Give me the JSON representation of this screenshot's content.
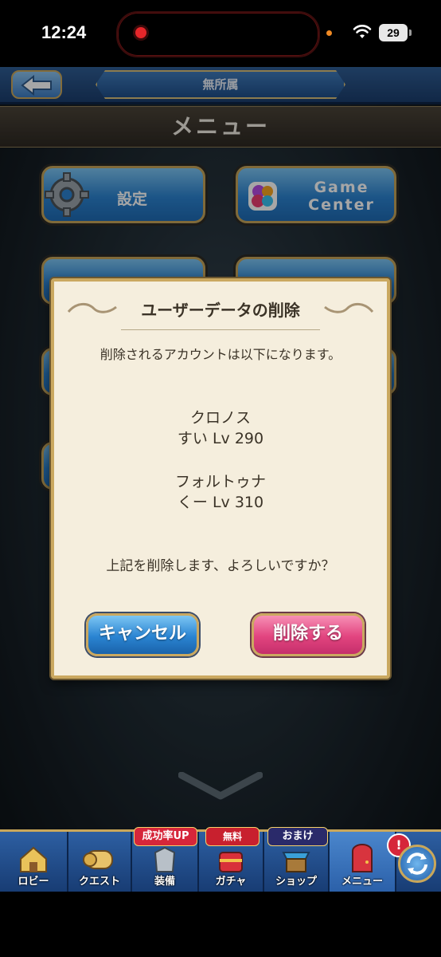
{
  "status_bar": {
    "time": "12:24",
    "battery": "29"
  },
  "header": {
    "affiliation": "無所属",
    "page_title": "メニュー"
  },
  "menu_buttons": {
    "settings": "設定",
    "gamecenter_line1": "Game",
    "gamecenter_line2": "Center"
  },
  "dialog": {
    "title": "ユーザーデータの削除",
    "description": "削除されるアカウントは以下になります。",
    "accounts": [
      {
        "server": "クロノス",
        "info": "すい Lv 290"
      },
      {
        "server": "フォルトゥナ",
        "info": "くー Lv 310"
      }
    ],
    "confirm": "上記を削除します、よろしいですか？",
    "cancel_label": "キャンセル",
    "delete_label": "削除する"
  },
  "bottom_nav": {
    "items": [
      {
        "label": "ロビー",
        "icon": "lobby-icon"
      },
      {
        "label": "クエスト",
        "icon": "quest-icon"
      },
      {
        "label": "装備",
        "icon": "equipment-icon",
        "badge": "成功率UP"
      },
      {
        "label": "ガチャ",
        "icon": "gacha-icon",
        "badge": "無料"
      },
      {
        "label": "ショップ",
        "icon": "shop-icon",
        "badge": "おまけ"
      },
      {
        "label": "メニュー",
        "icon": "menu-door-icon"
      }
    ],
    "alert_mark": "!"
  },
  "colors": {
    "dialog_bg": "#f5eedd",
    "gold": "#caa860",
    "blue_button": "#2a84d2",
    "pink_button": "#e2447f",
    "nav_bg": "#2d5fa2"
  }
}
